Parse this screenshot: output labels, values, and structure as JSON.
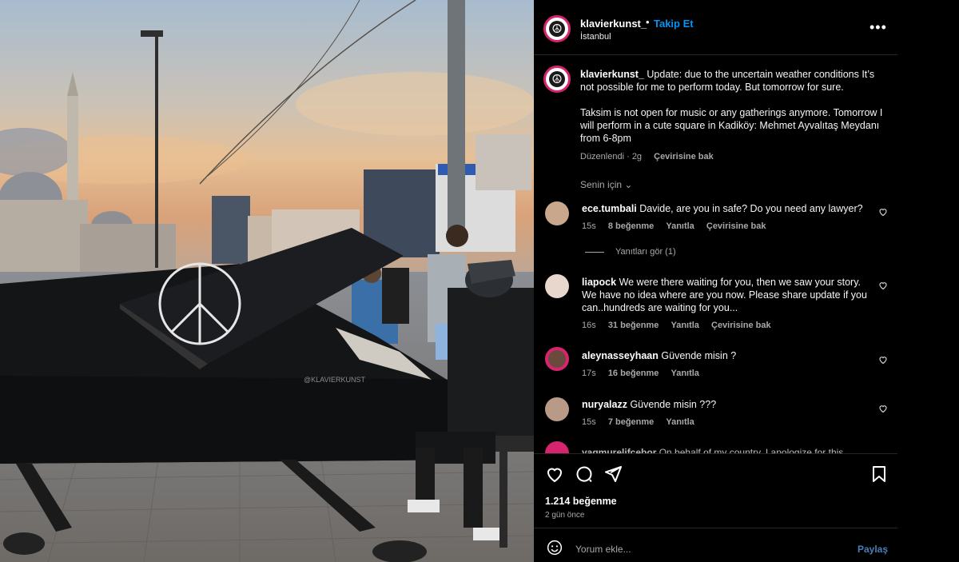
{
  "post": {
    "username": "klavierkunst_",
    "separator": "•",
    "follow_label": "Takip Et",
    "location": "İstanbul",
    "more_label": "•••"
  },
  "caption": {
    "username": "klavierkunst_",
    "line1": "Update: due to the uncertain weather conditions It’s not possible for me to perform today. But tomorrow for sure.",
    "line2": "Taksim is not open for music or any gatherings anymore. Tomorrow I will perform in a cute square in Kadiköy: Mehmet Ayvalıtaş Meydanı from 6-8pm",
    "edited": "Düzenlendi · 2g",
    "translate": "Çevirisine bak"
  },
  "sort_label": "Senin için ⌄",
  "comments": [
    {
      "user": "ece.tumbali",
      "text": "Davide, are you in safe? Do you need any lawyer?",
      "time": "15s",
      "likes": "8 beğenme",
      "reply": "Yanıtla",
      "translate": "Çevirisine bak"
    },
    {
      "user": "liapock",
      "text": "We were there waiting for you, then we saw your story. We have no idea where are you now. Please share update if you can..hundreds are waiting for you...",
      "time": "16s",
      "likes": "31 beğenme",
      "reply": "Yanıtla",
      "translate": "Çevirisine bak"
    },
    {
      "user": "aleynasseyhaan",
      "text": "Güvende misin ?",
      "time": "17s",
      "likes": "16 beğenme",
      "reply": "Yanıtla"
    },
    {
      "user": "nuryalazz",
      "text": "Güvende misin ???",
      "time": "15s",
      "likes": "7 beğenme",
      "reply": "Yanıtla"
    },
    {
      "user": "yagmurelifcebor",
      "text": "On behalf of my country, I apologize for this"
    }
  ],
  "view_replies": "Yanıtları gör (1)",
  "likes_count": "1.214 beğenme",
  "time_ago": "2 gün önce",
  "add_comment": {
    "placeholder": "Yorum ekle...",
    "post_label": "Paylaş"
  },
  "media": {
    "piano_brand": "@KLAVIERKUNST"
  },
  "icons": {
    "avatar": "peace-sign-icon",
    "like": "heart-icon",
    "comment": "comment-bubble-icon",
    "share": "paper-plane-icon",
    "save": "bookmark-icon",
    "emoji": "smiley-icon"
  },
  "colors": {
    "accent": "#0095f6",
    "bg": "#000000",
    "muted": "#a8a8a8"
  }
}
